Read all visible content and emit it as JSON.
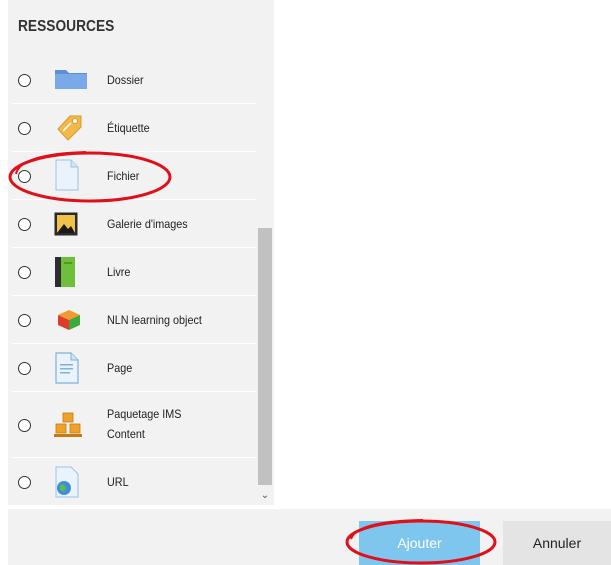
{
  "section": {
    "title": "RESSOURCES"
  },
  "items": [
    {
      "label": "Dossier",
      "icon": "folder-icon"
    },
    {
      "label": "Étiquette",
      "icon": "tag-icon"
    },
    {
      "label": "Fichier",
      "icon": "file-icon"
    },
    {
      "label": "Galerie d'images",
      "icon": "image-gallery-icon"
    },
    {
      "label": "Livre",
      "icon": "book-icon"
    },
    {
      "label": "NLN learning object",
      "icon": "learning-object-icon"
    },
    {
      "label": "Page",
      "icon": "page-icon"
    },
    {
      "label_line1": "Paquetage IMS",
      "label_line2": "Content",
      "icon": "ims-package-icon"
    },
    {
      "label": "URL",
      "icon": "url-icon"
    }
  ],
  "buttons": {
    "add": "Ajouter",
    "cancel": "Annuler"
  },
  "colors": {
    "add_button": "#7fc6ef",
    "highlight": "#e0101a",
    "panel": "#f2f2f2"
  }
}
